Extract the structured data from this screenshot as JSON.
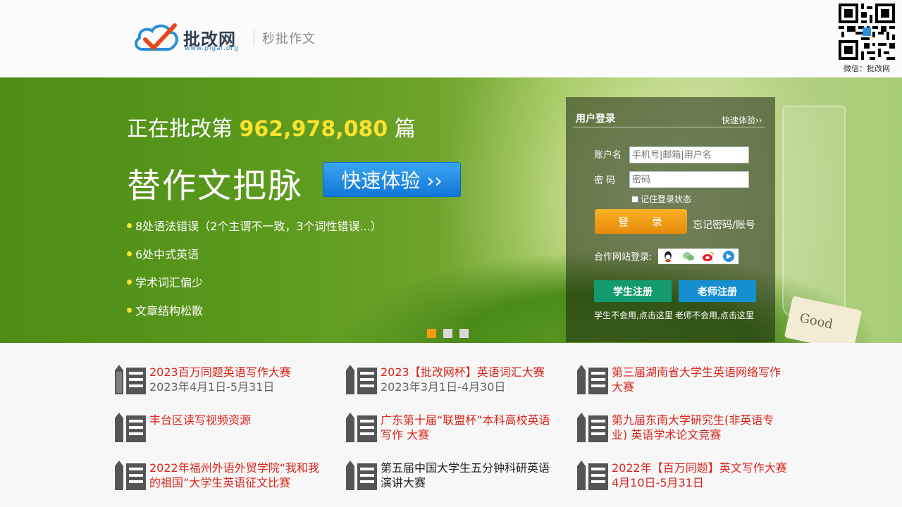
{
  "header": {
    "logo_title": "批改网",
    "logo_url": "www.pigai.org",
    "slogan": "秒批作文",
    "qr_caption": "微信：批改网"
  },
  "banner": {
    "counter_prefix": "正在批改第",
    "counter_number": "962,978,080",
    "counter_suffix": "篇",
    "big_title": "替作文把脉",
    "quick_button": "快速体验 ››",
    "bullets": [
      "8处语法错误（2个主谓不一致，3个词性错误...）",
      "6处中式英语",
      "学术词汇偏少",
      "文章结构松散"
    ],
    "tag_text": "Good",
    "slides": 3,
    "active_slide": 1
  },
  "login": {
    "title": "用户登录",
    "quick_link": "快速体验››",
    "username_label": "账户名",
    "username_placeholder": "手机号|邮箱|用户名",
    "password_label": "密 码",
    "password_placeholder": "密码",
    "remember_label": "记住登录状态",
    "login_button": "登 录",
    "forgot_link": "忘记密码/账号",
    "partner_label": "合作网站登录:",
    "partner_icons": [
      "qq-icon",
      "wechat-icon",
      "weibo-icon",
      "partner-icon"
    ],
    "student_register": "学生注册",
    "teacher_register": "老师注册",
    "student_help": "学生不会用,点击这里",
    "teacher_help": "老师不会用,点击这里"
  },
  "colors": {
    "accent_red": "#d9241b",
    "highlight_yellow": "#ffe12e",
    "login_orange": "#e78a0b",
    "student_green": "#139a6e",
    "teacher_blue": "#168fd0"
  },
  "news": [
    {
      "title": "2023百万同题英语写作大赛",
      "date": "2023年4月1日-5月31日",
      "color": "red"
    },
    {
      "title": "2023【批改网杯】英语词汇大赛",
      "date": "2023年3月1日-4月30日",
      "color": "red"
    },
    {
      "title": "第三届湖南省大学生英语网络写作大赛",
      "date": "",
      "color": "red"
    },
    {
      "title": "丰台区读写视频资源",
      "date": "",
      "color": "red"
    },
    {
      "title": "广东第十届“联盟杯”本科高校英语写作 大赛",
      "date": "",
      "color": "red"
    },
    {
      "title": "第九届东南大学研究生(非英语专业) 英语学术论文竞赛",
      "date": "",
      "color": "red"
    },
    {
      "title": "2022年福州外语外贸学院“我和我的祖国”大学生英语征文比赛",
      "date": "",
      "color": "red"
    },
    {
      "title": "第五届中国大学生五分钟科研英语演讲大赛",
      "date": "",
      "color": "black"
    },
    {
      "title": "2022年【百万同题】英文写作大赛",
      "date": "4月10日-5月31日",
      "color": "red-date"
    }
  ]
}
